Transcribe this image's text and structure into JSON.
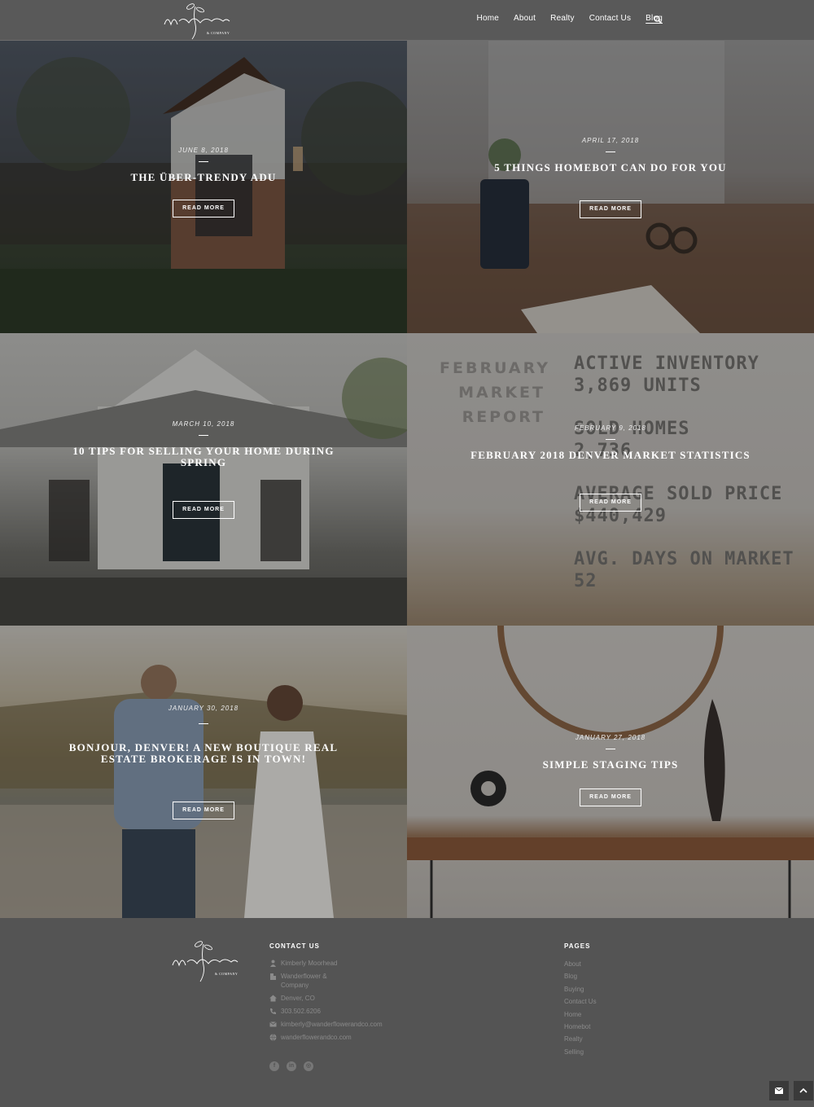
{
  "nav": {
    "items": [
      {
        "label": "Home",
        "active": false
      },
      {
        "label": "About",
        "active": false
      },
      {
        "label": "Realty",
        "active": false
      },
      {
        "label": "Contact Us",
        "active": false
      },
      {
        "label": "Blog",
        "active": true
      }
    ],
    "search_icon": "search-icon"
  },
  "posts": [
    {
      "date": "JUNE 8, 2018",
      "title": "THE ÜBER-TRENDY ADU",
      "button": "READ MORE"
    },
    {
      "date": "APRIL 17, 2018",
      "title": "5 THINGS HOMEBOT CAN DO FOR YOU",
      "button": "READ MORE"
    },
    {
      "date": "MARCH 10, 2018",
      "title": "10 TIPS FOR SELLING YOUR HOME DURING SPRING",
      "button": "READ MORE"
    },
    {
      "date": "FEBRUARY 9, 2018",
      "title": "FEBRUARY 2018 DENVER MARKET STATISTICS",
      "button": "READ MORE"
    },
    {
      "date": "JANUARY 30, 2018",
      "title": "BONJOUR, DENVER! A NEW BOUTIQUE REAL ESTATE BROKERAGE IS IN TOWN!",
      "button": "READ MORE"
    },
    {
      "date": "JANUARY 27, 2018",
      "title": "SIMPLE STAGING TIPS",
      "button": "READ MORE"
    }
  ],
  "market_image": {
    "left": [
      "FEBRUARY",
      "MARKET",
      "REPORT"
    ],
    "right": [
      "ACTIVE INVENTORY",
      "3,869 UNITS",
      "SOLD HOMES",
      "2,736",
      "AVERAGE SOLD PRICE",
      "$440,429",
      "AVG. DAYS ON MARKET",
      "52"
    ]
  },
  "footer": {
    "contact_heading": "CONTACT US",
    "contact": [
      {
        "icon": "person-icon",
        "text": "Kimberly Moorhead"
      },
      {
        "icon": "building-icon",
        "text": "Wanderflower & Company"
      },
      {
        "icon": "home-icon",
        "text": "Denver, CO"
      },
      {
        "icon": "phone-icon",
        "text": "303.502.6206"
      },
      {
        "icon": "envelope-icon",
        "text": "kimberly@wanderflowerandco.com"
      },
      {
        "icon": "globe-icon",
        "text": "wanderflowerandco.com"
      }
    ],
    "pages_heading": "PAGES",
    "pages": [
      "About",
      "Blog",
      "Buying",
      "Contact Us",
      "Home",
      "Homebot",
      "Realty",
      "Selling"
    ],
    "socials": [
      "facebook-icon",
      "linkedin-icon",
      "instagram-icon"
    ]
  },
  "colors": {
    "header": "#595959",
    "footer": "#545454",
    "text": "#ffffff",
    "muted": "#8a8a8a"
  }
}
